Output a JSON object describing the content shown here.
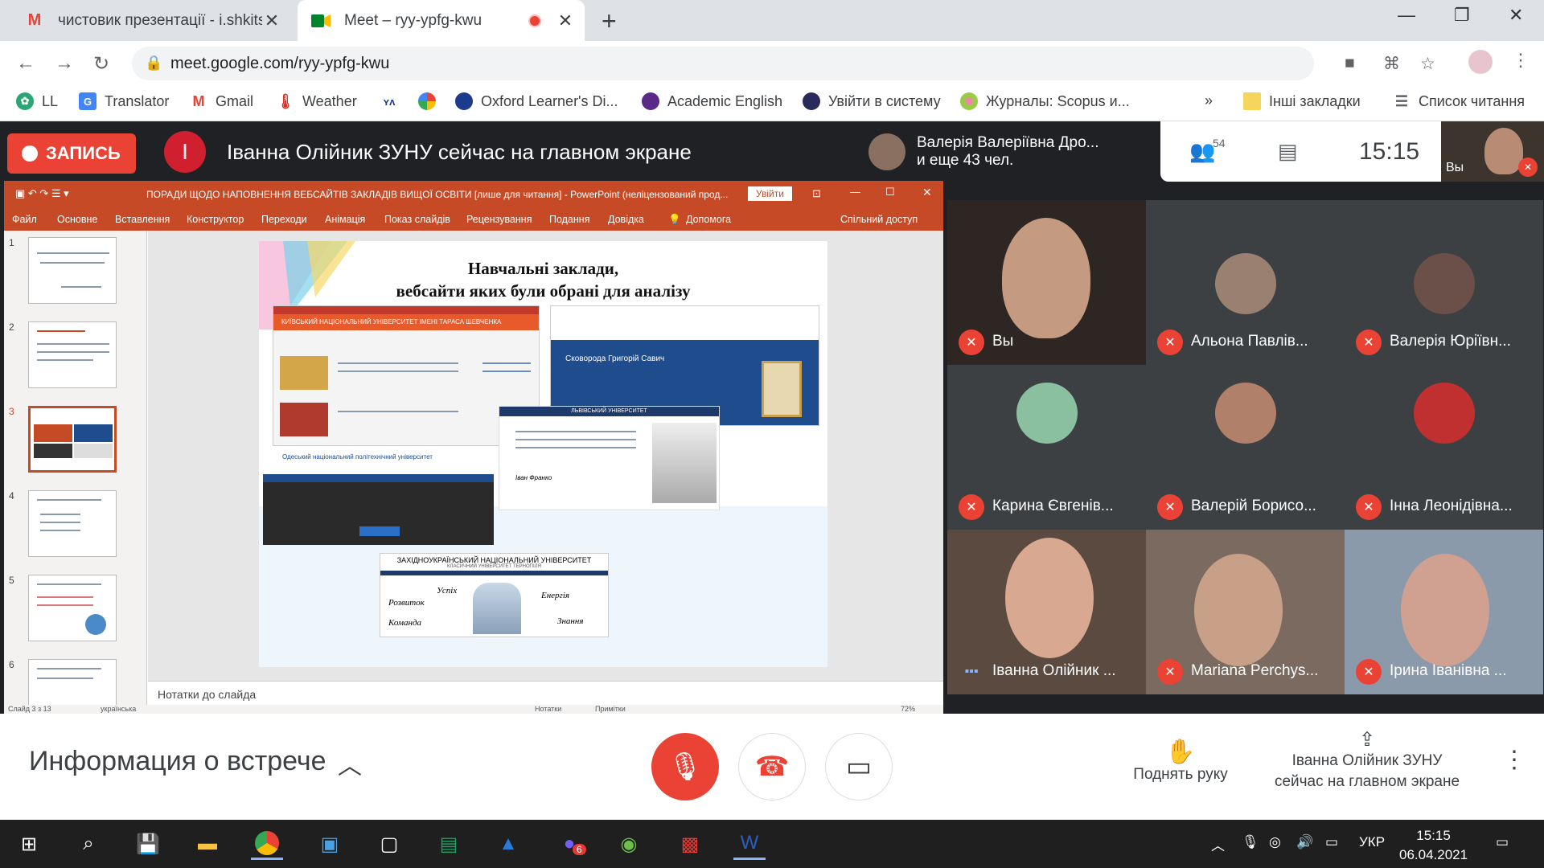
{
  "browser": {
    "tabs": [
      {
        "title": "чистовик презентації - i.shkitska",
        "close": "✕"
      },
      {
        "title": "Meet – ryy-ypfg-kwu",
        "close": "✕"
      }
    ],
    "new_tab": "+",
    "url": "meet.google.com/ryy-ypfg-kwu",
    "bookmarks": [
      "LL",
      "Translator",
      "Gmail",
      "Weather",
      "Oxford Learner's Di...",
      "Academic English",
      "Увійти в систему",
      "Журналы: Scopus и..."
    ],
    "bookmarks_more": "»",
    "other_bookmarks": "Інші закладки",
    "reading_list": "Список читання"
  },
  "meet": {
    "record_label": "ЗАПИСЬ",
    "presenter_initial": "I",
    "presenting_message": "Іванна Олійник ЗУНУ сейчас на главном экране",
    "joined_name": "Валерія Валеріївна Дро...",
    "joined_more": "и еще 43 чел.",
    "participants_count": "54",
    "time": "15:15",
    "self_label": "Вы",
    "participants": [
      {
        "name": "Вы"
      },
      {
        "name": "Альона Павлів..."
      },
      {
        "name": "Валерія Юріївн..."
      },
      {
        "name": "Карина Євгенів..."
      },
      {
        "name": "Валерій Борисо..."
      },
      {
        "name": "Інна Леонідівна..."
      },
      {
        "name": "Іванна Олійник ..."
      },
      {
        "name": "Mariana Perchys..."
      },
      {
        "name": "Ірина Іванівна ..."
      }
    ],
    "meeting_info": "Информация о встрече",
    "raise_hand": "Поднять руку",
    "presenting_now_line1": "Іванна Олійник ЗУНУ",
    "presenting_now_line2": "сейчас на главном экране"
  },
  "powerpoint": {
    "title": "ПОРАДИ ЩОДО НАПОВНЕННЯ ВЕБСАЙТІВ ЗАКЛАДІВ ВИЩОЇ ОСВІТИ [лише для читання] - PowerPoint (неліцензований прод...",
    "sign_in": "Увійти",
    "menu": [
      "Файл",
      "Основне",
      "Вставлення",
      "Конструктор",
      "Переходи",
      "Анімація",
      "Показ слайдів",
      "Рецензування",
      "Подання",
      "Довідка",
      "Допомога",
      "Спільний доступ"
    ],
    "slide_numbers": [
      "1",
      "2",
      "3",
      "4",
      "5",
      "6"
    ],
    "slide_title_1": "Навчальні заклади,",
    "slide_title_2": "вебсайти яких були обрані для аналізу",
    "uni_1": "КИЇВСЬКИЙ НАЦІОНАЛЬНИЙ УНІВЕРСИТЕТ ІМЕНІ ТАРАСА ШЕВЧЕНКА",
    "uni_2": "Сковорода Григорій Савич",
    "uni_3": "Одеський національний політехнічний університет",
    "uni_4": "ЛЬВІВСЬКИЙ УНІВЕРСИТЕТ",
    "uni_4_sig": "Іван Франко",
    "uni_5": "ЗАХІДНОУКРАЇНСЬКИЙ НАЦІОНАЛЬНИЙ УНІВЕРСИТЕТ",
    "uni_5_sub": "КЛАСИЧНИЙ УНІВЕРСИТЕТ ТЕРНОПІЛЯ",
    "uni_5_words": [
      "Розвиток",
      "Успіх",
      "Команда",
      "Енергія",
      "Знання"
    ],
    "notes": "Нотатки до слайда",
    "status_slide": "Слайд 3 з 13",
    "status_lang": "українська",
    "status_notes": "Нотатки",
    "status_comments": "Примітки",
    "zoom": "72%"
  },
  "taskbar": {
    "lang": "УКР",
    "time": "15:15",
    "date": "06.04.2021",
    "viber_badge": "6"
  }
}
